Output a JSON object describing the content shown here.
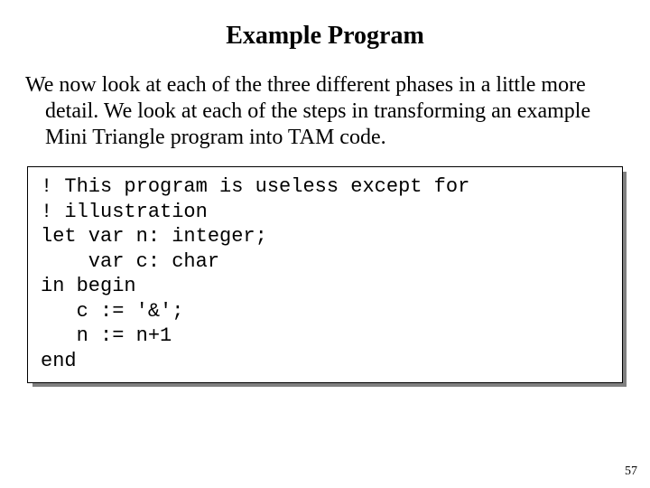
{
  "title": "Example Program",
  "paragraph": "We now look at each of the three different phases in a little more detail. We look at each of the steps in transforming an example Mini Triangle program into TAM code.",
  "code": "! This program is useless except for\n! illustration\nlet var n: integer;\n    var c: char\nin begin\n   c := '&';\n   n := n+1\nend",
  "page_number": "57"
}
